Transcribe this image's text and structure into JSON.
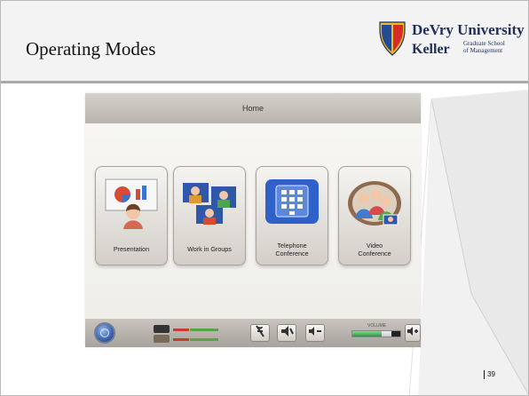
{
  "slide": {
    "title": "Operating Modes",
    "page_number": "39"
  },
  "logo": {
    "line1": "DeVry University",
    "line2": "Keller",
    "subtitle_line1": "Graduate School",
    "subtitle_line2": "of Management"
  },
  "screen": {
    "title": "Home",
    "modes": [
      {
        "label_lines": [
          "Presentation"
        ],
        "icon": "presentation-icon"
      },
      {
        "label_lines": [
          "Work in Groups"
        ],
        "icon": "group-work-icon"
      },
      {
        "label_lines": [
          "Telephone",
          "Conference"
        ],
        "icon": "telephone-icon"
      },
      {
        "label_lines": [
          "Video",
          "Conference"
        ],
        "icon": "video-conference-icon"
      }
    ],
    "volume_label": "VOLUME",
    "volume_level": 0.62,
    "colors": {
      "header": "#f3f3f3",
      "panel_header": "#c8c4be",
      "accent_blue": "#2f59a8"
    }
  }
}
